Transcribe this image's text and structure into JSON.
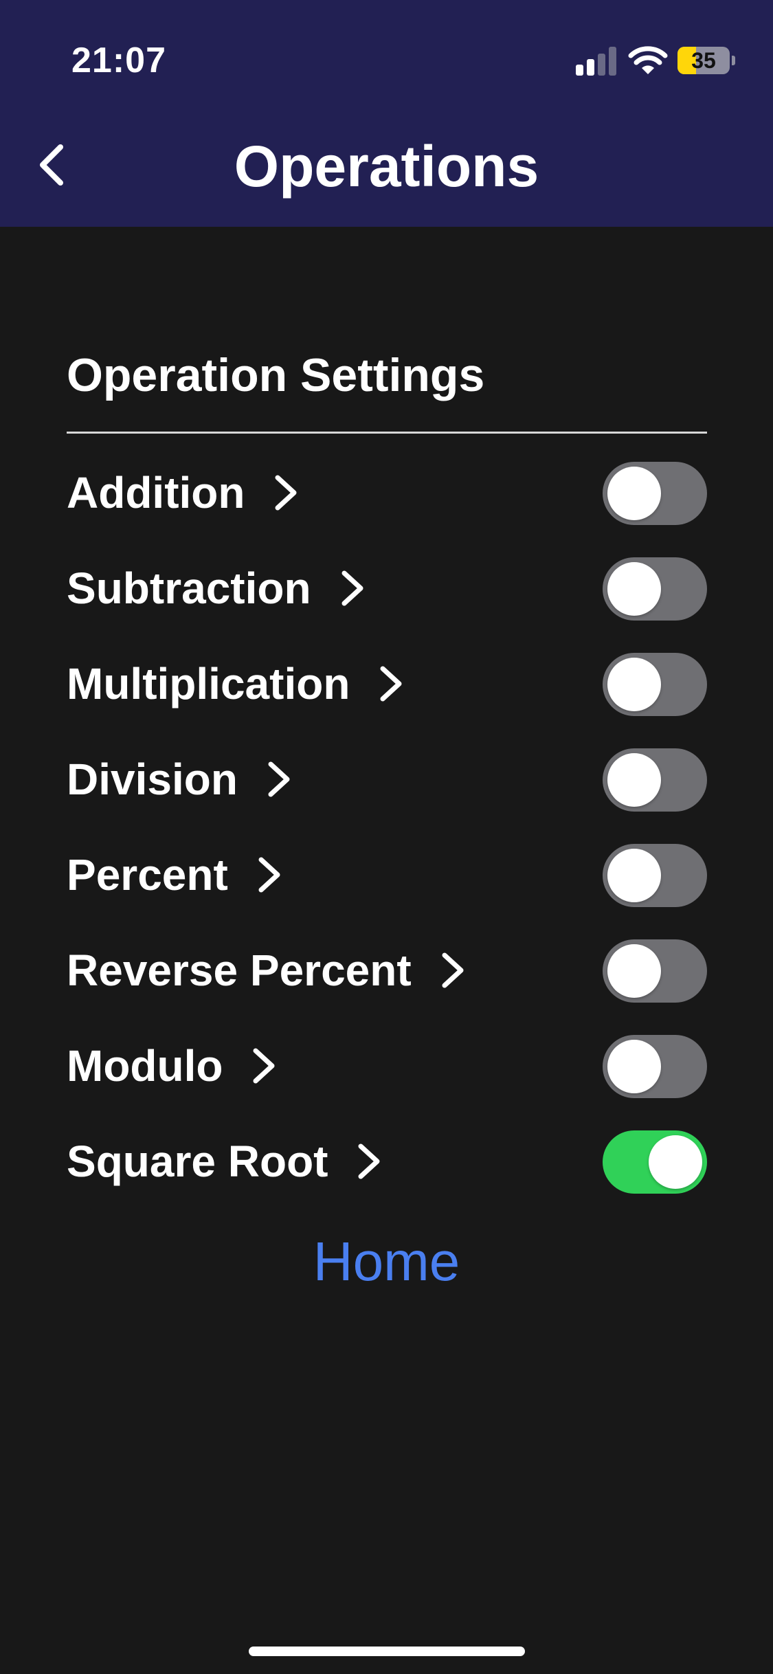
{
  "status_bar": {
    "time": "21:07",
    "battery": "35",
    "battery_level": 0.35,
    "signal_bars_active": 2,
    "signal_bars_total": 4
  },
  "nav": {
    "title": "Operations",
    "back_icon": "chevron-left-icon"
  },
  "section": {
    "title": "Operation Settings"
  },
  "operations": [
    {
      "label": "Addition",
      "enabled": false
    },
    {
      "label": "Subtraction",
      "enabled": false
    },
    {
      "label": "Multiplication",
      "enabled": false
    },
    {
      "label": "Division",
      "enabled": false
    },
    {
      "label": "Percent",
      "enabled": false
    },
    {
      "label": "Reverse Percent",
      "enabled": false
    },
    {
      "label": "Modulo",
      "enabled": false
    },
    {
      "label": "Square Root",
      "enabled": true
    }
  ],
  "footer": {
    "home_label": "Home"
  },
  "colors": {
    "header_bg": "#222053",
    "page_bg": "#181818",
    "toggle_on": "#30d158",
    "toggle_off": "#6f6f73",
    "link": "#4a7ff0",
    "battery_fill": "#ffd60a"
  }
}
